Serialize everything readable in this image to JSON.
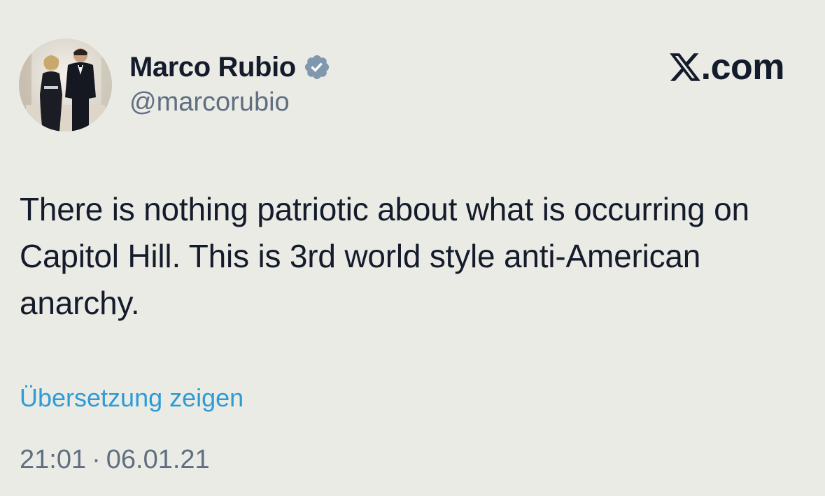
{
  "author": {
    "display_name": "Marco Rubio",
    "handle": "@marcorubio",
    "verified": true,
    "verified_icon": "verified-badge-icon"
  },
  "site": {
    "label": ".com",
    "logo_icon": "x-logo-icon"
  },
  "tweet": {
    "text": "There is nothing patriotic about what is occurring on Capitol Hill. This is 3rd world style anti-American anarchy.",
    "translate_label": "Übersetzung zeigen",
    "time": "21:01",
    "separator": "·",
    "date": "06.01.21"
  },
  "colors": {
    "background": "#ebebe6",
    "text": "#141b2b",
    "secondary": "#5f6f80",
    "link": "#2f9bd6",
    "badge": "#8197ad"
  }
}
